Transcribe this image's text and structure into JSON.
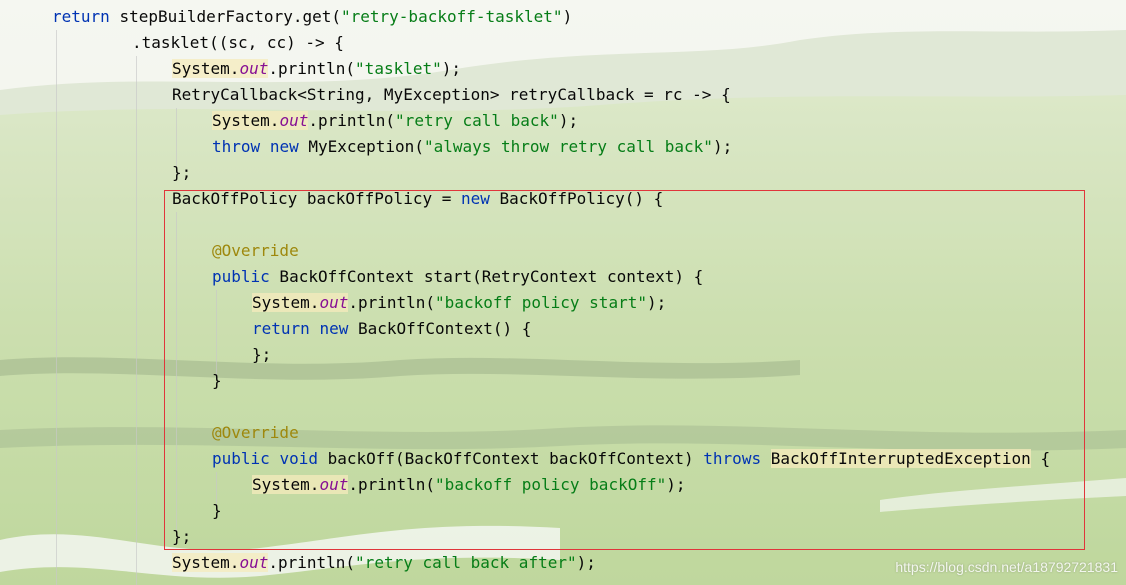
{
  "editor": {
    "lines": {
      "l1": {
        "a": "return",
        "b": " ",
        "c": "stepBuilderFactory",
        "d": ".get(",
        "e": "\"retry-backoff-tasklet\"",
        "f": ")"
      },
      "l2": {
        "a": ".tasklet((sc, cc) -> {"
      },
      "l3": {
        "a": "System.",
        "b": "out",
        "c": ".println(",
        "d": "\"tasklet\"",
        "e": ");"
      },
      "l4": {
        "a": "RetryCallback<String, MyException> retryCallback = rc -> {"
      },
      "l5": {
        "a": "System.",
        "b": "out",
        "c": ".println(",
        "d": "\"retry call back\"",
        "e": ");"
      },
      "l6": {
        "a": "throw",
        "b": " ",
        "c": "new",
        "d": " MyException(",
        "e": "\"always throw retry call back\"",
        "f": ");"
      },
      "l7": {
        "a": "};"
      },
      "l8": {
        "a": "BackOffPolicy backOffPolicy = ",
        "b": "new",
        "c": " BackOffPolicy() {"
      },
      "l9": {
        "a": "@Override"
      },
      "l10": {
        "a": "public",
        "b": " BackOffContext start(RetryContext context) {"
      },
      "l11": {
        "a": "System.",
        "b": "out",
        "c": ".println(",
        "d": "\"backoff policy start\"",
        "e": ");"
      },
      "l12": {
        "a": "return",
        "b": " ",
        "c": "new",
        "d": " BackOffContext() {"
      },
      "l13": {
        "a": "};"
      },
      "l14": {
        "a": "}"
      },
      "l15": {
        "a": "@Override"
      },
      "l16": {
        "a": "public",
        "b": " ",
        "c": "void",
        "d": " backOff(BackOffContext backOffContext) ",
        "e": "throws",
        "f": " ",
        "g": "BackOffInterruptedException",
        "h": " {"
      },
      "l17": {
        "a": "System.",
        "b": "out",
        "c": ".println(",
        "d": "\"backoff policy backOff\"",
        "e": ");"
      },
      "l18": {
        "a": "}"
      },
      "l19": {
        "a": "};"
      },
      "l20": {
        "a": "System.",
        "b": "out",
        "c": ".println(",
        "d": "\"retry call back after\"",
        "e": ");"
      }
    }
  },
  "watermark": {
    "text": "https://blog.csdn.net/a18792721831"
  },
  "colors": {
    "keyword": "#0033b3",
    "string": "#067d17",
    "field": "#871094",
    "annotation": "#9e880d",
    "highlight_box": "#e0353b"
  }
}
